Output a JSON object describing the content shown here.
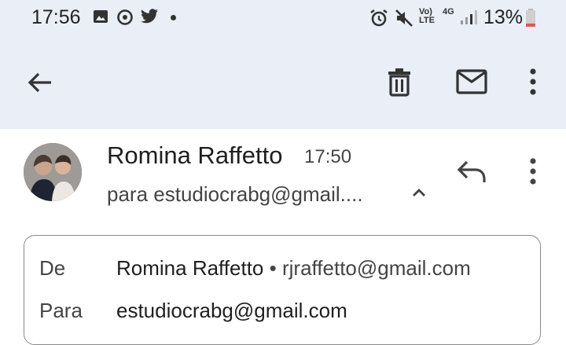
{
  "status_bar": {
    "time": "17:56",
    "lte_label": "Vo)\nLTE",
    "network_label": "4G",
    "battery_percent": "13%",
    "icons": [
      "image-icon",
      "sync-icon",
      "twitter-icon",
      "dot-icon",
      "alarm-icon",
      "mute-icon",
      "signal-icon",
      "battery-icon"
    ]
  },
  "toolbar": {
    "icons": [
      "back-arrow-icon",
      "trash-icon",
      "mail-icon",
      "more-vert-icon"
    ]
  },
  "message": {
    "sender": "Romina Raffetto",
    "time": "17:50",
    "to_summary": "para estudiocrabg@gmail....",
    "details": {
      "from_label": "De",
      "from_name": "Romina Raffetto",
      "separator": "•",
      "from_email": "rjraffetto@gmail.com",
      "to_label": "Para",
      "to_email": "estudiocrabg@gmail.com"
    }
  },
  "colors": {
    "topbar_bg": "#e9eef7",
    "text_primary": "#1f1f1f",
    "text_secondary": "#444444",
    "battery_low": "#e0574a"
  }
}
